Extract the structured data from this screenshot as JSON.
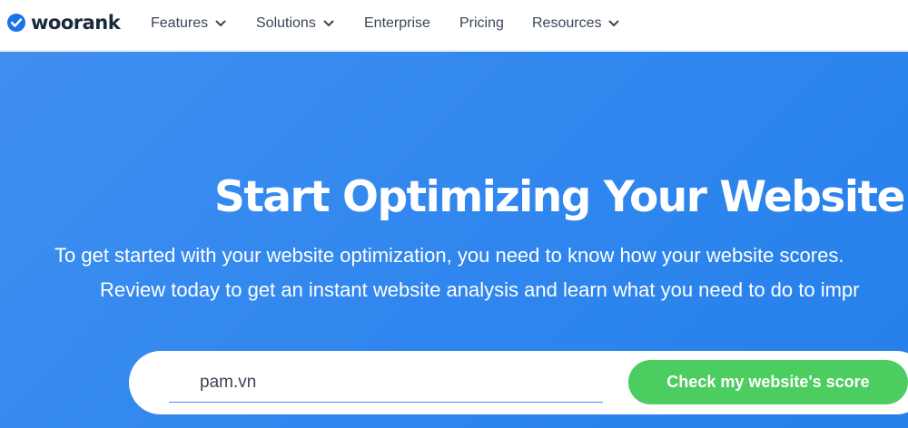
{
  "brand": {
    "name": "woorank",
    "accent": "#1a73e8"
  },
  "nav": {
    "items": [
      {
        "label": "Features",
        "has_dropdown": true,
        "icon": "chevron-down-icon"
      },
      {
        "label": "Solutions",
        "has_dropdown": true,
        "icon": "chevron-down-icon"
      },
      {
        "label": "Enterprise",
        "has_dropdown": false
      },
      {
        "label": "Pricing",
        "has_dropdown": false
      },
      {
        "label": "Resources",
        "has_dropdown": true,
        "icon": "chevron-down-icon"
      }
    ]
  },
  "hero": {
    "title": "Start Optimizing Your Website",
    "line1": "To get started with your website optimization, you need to know how your website scores.",
    "line2": "Review today to get an instant website analysis and learn what you need to do to impr",
    "background": "#2f86ee"
  },
  "search": {
    "value": "pam.vn",
    "button_label": "Check my website's score",
    "button_color": "#4ccd5f"
  }
}
